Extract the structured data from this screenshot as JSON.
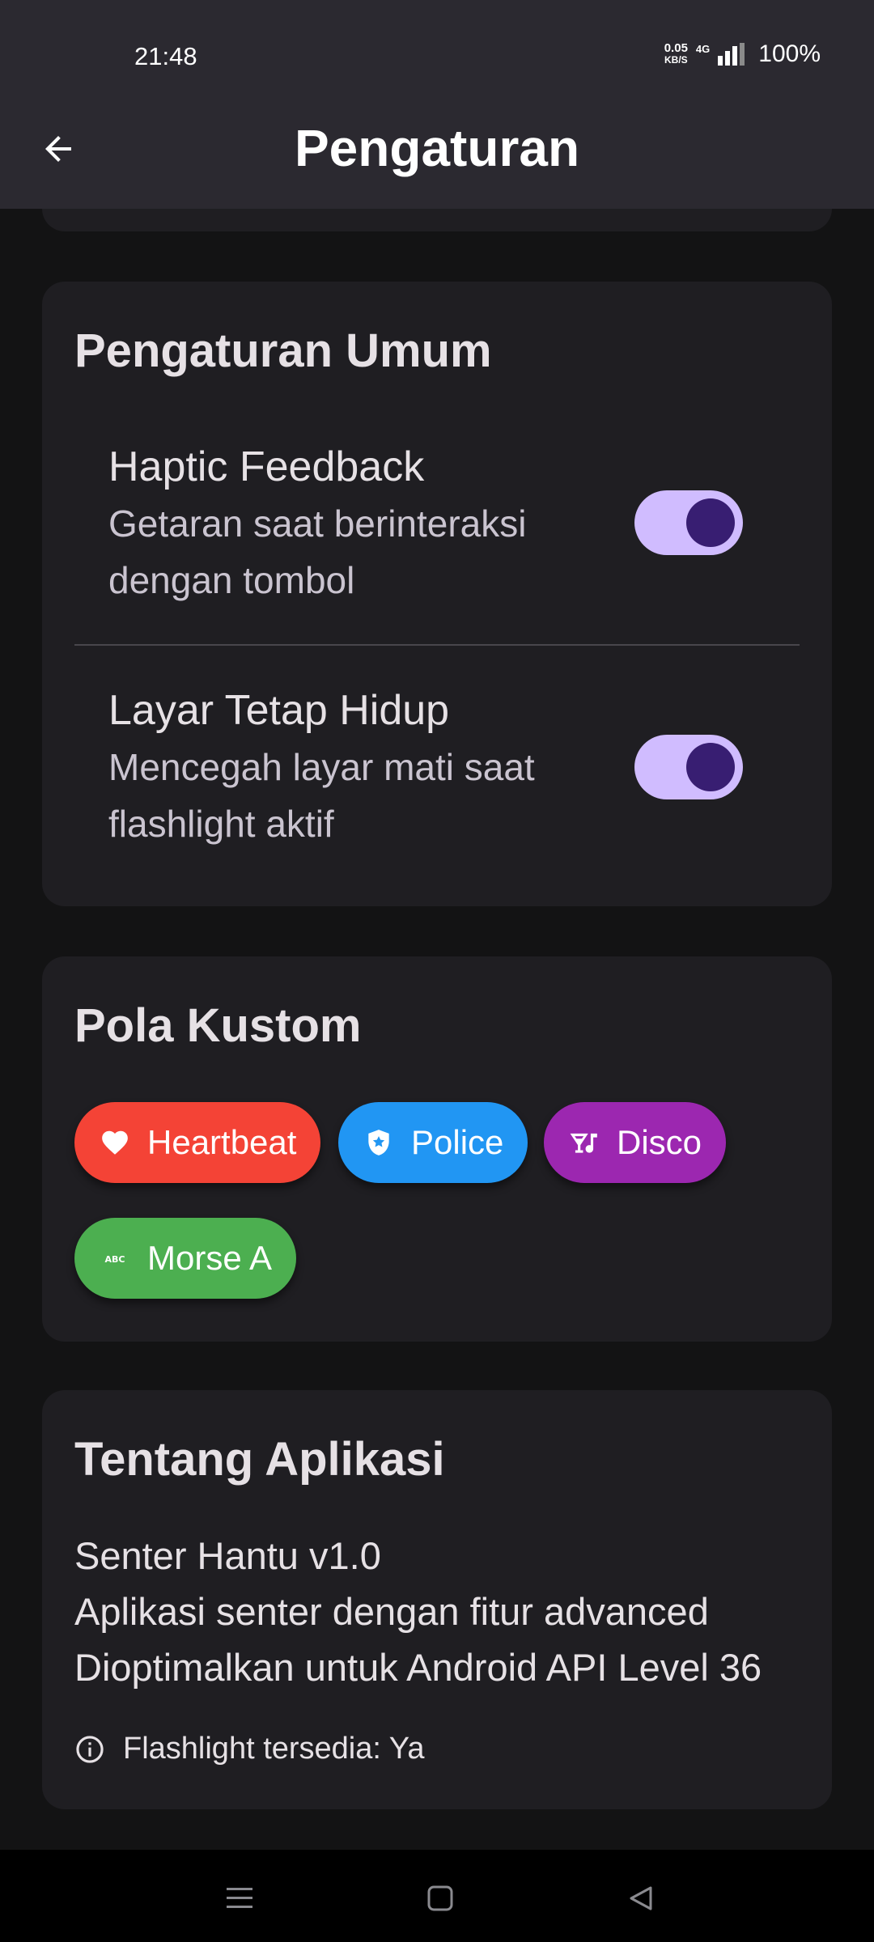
{
  "status_bar": {
    "time": "21:48",
    "net_speed_value": "0.05",
    "net_speed_unit": "KB/S",
    "network_type": "4G",
    "battery": "100%"
  },
  "app_bar": {
    "title": "Pengaturan",
    "back_icon": "arrow-back-icon"
  },
  "general_settings": {
    "title": "Pengaturan Umum",
    "items": [
      {
        "title": "Haptic Feedback",
        "subtitle_line1": "Getaran saat berinteraksi",
        "subtitle_line2": "dengan tombol",
        "enabled": true
      },
      {
        "title": "Layar Tetap Hidup",
        "subtitle_line1": "Mencegah layar mati saat",
        "subtitle_line2": "flashlight aktif",
        "enabled": true
      }
    ]
  },
  "custom_patterns": {
    "title": "Pola Kustom",
    "chips": [
      {
        "label": "Heartbeat",
        "icon": "heart-icon",
        "color": "#f44336"
      },
      {
        "label": "Police",
        "icon": "police-badge-icon",
        "color": "#2196f3"
      },
      {
        "label": "Disco",
        "icon": "nightlife-icon",
        "color": "#9c27b0"
      },
      {
        "label": "Morse A",
        "icon": "abc-icon",
        "color": "#4caf50"
      }
    ]
  },
  "about": {
    "title": "Tentang Aplikasi",
    "line1": "Senter Hantu v1.0",
    "line2": "Aplikasi senter dengan fitur advanced",
    "line3": "Dioptimalkan untuk Android API Level 36",
    "info": "Flashlight tersedia: Ya",
    "info_icon": "info-icon"
  },
  "nav_bar": {
    "icons": [
      "menu-icon",
      "home-icon",
      "back-triangle-icon"
    ]
  },
  "colors": {
    "background": "#131314",
    "card": "#1f1e22",
    "app_bar": "#2b2930",
    "toggle_track": "#d0bcff",
    "toggle_knob": "#381e72"
  }
}
